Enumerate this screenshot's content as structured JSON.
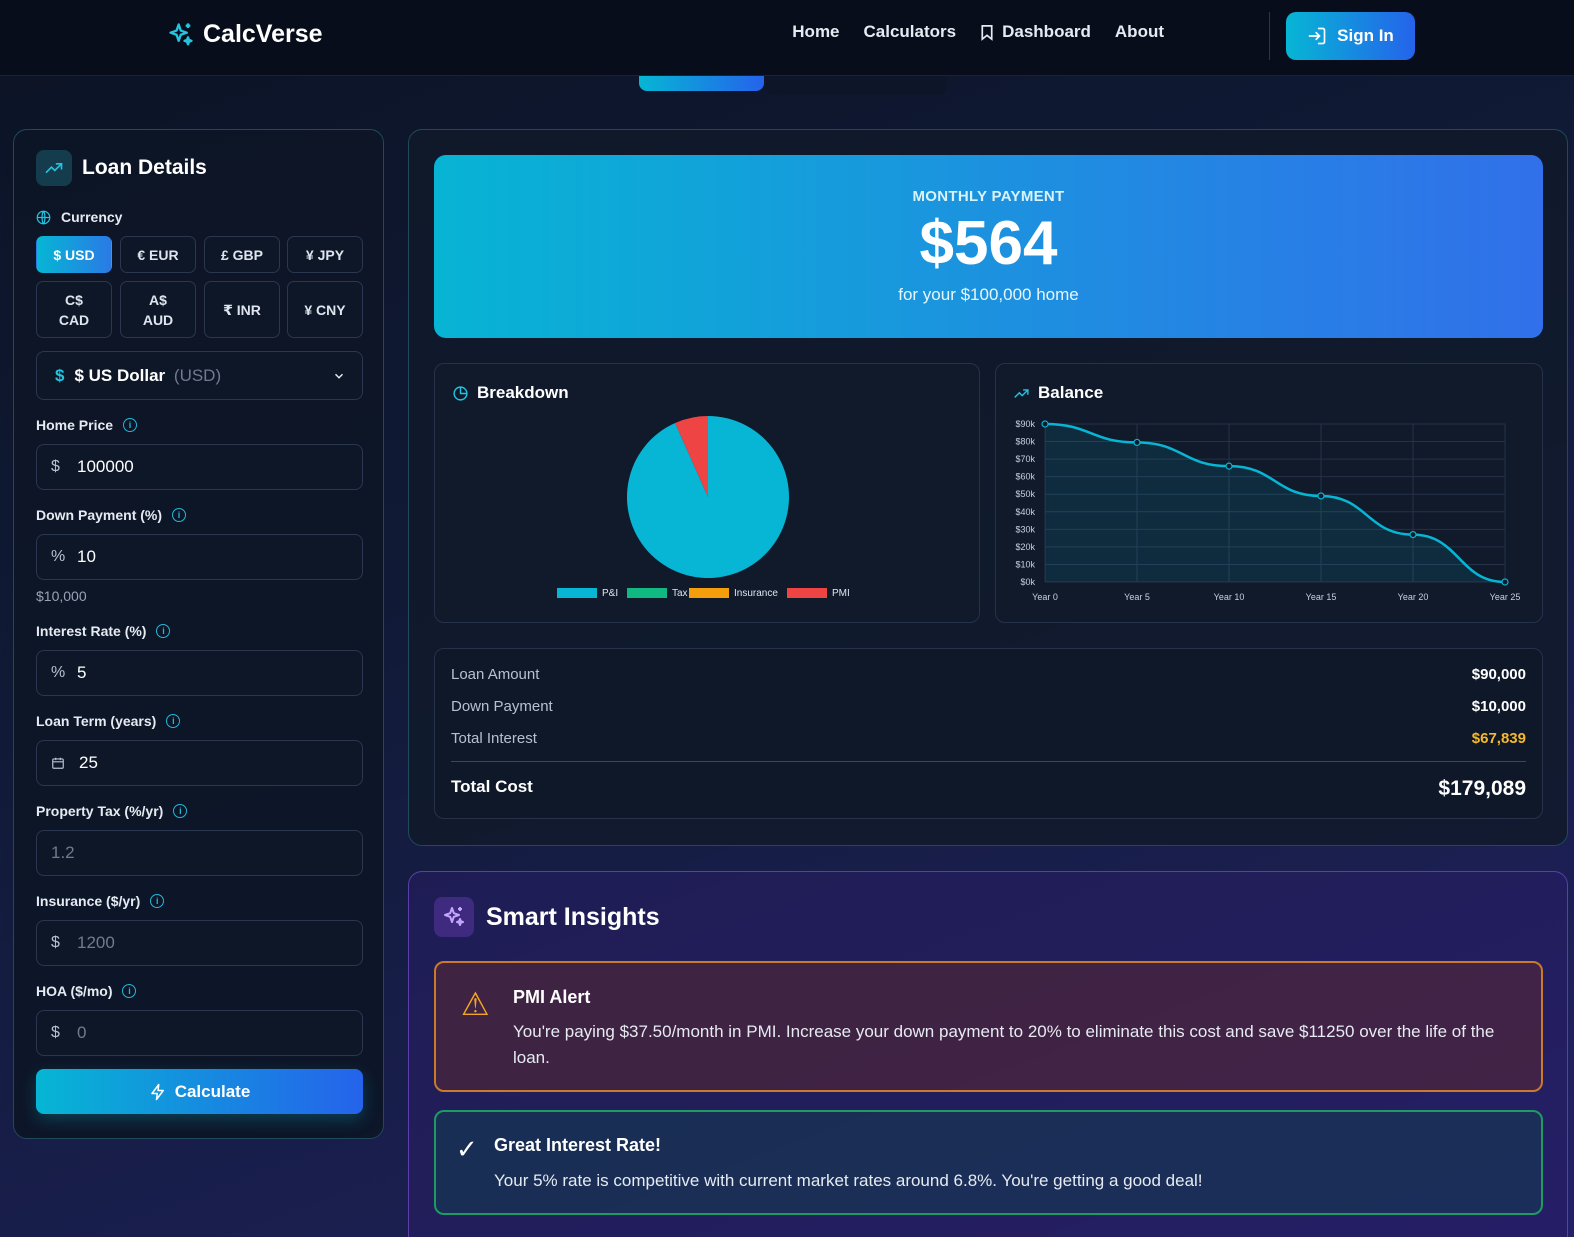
{
  "nav": {
    "brand": "CalcVerse",
    "links": [
      "Home",
      "Calculators",
      "Dashboard",
      "About"
    ],
    "signin": "Sign In"
  },
  "loan": {
    "title": "Loan Details",
    "currency_label": "Currency",
    "currencies": [
      {
        "line1": "$ USD",
        "line2": ""
      },
      {
        "line1": "€ EUR",
        "line2": ""
      },
      {
        "line1": "£ GBP",
        "line2": ""
      },
      {
        "line1": "¥ JPY",
        "line2": ""
      },
      {
        "line1": "C$",
        "line2": "CAD"
      },
      {
        "line1": "A$",
        "line2": "AUD"
      },
      {
        "line1": "₹ INR",
        "line2": ""
      },
      {
        "line1": "¥ CNY",
        "line2": ""
      }
    ],
    "select": {
      "symbol": "$",
      "name": "$ US Dollar",
      "code": "(USD)"
    },
    "fields": [
      {
        "label": "Home Price",
        "prefix": "$",
        "value": "100000",
        "placeholder": ""
      },
      {
        "label": "Down Payment (%)",
        "prefix": "%",
        "value": "10",
        "placeholder": ""
      },
      {
        "label": "Interest Rate (%)",
        "prefix": "%",
        "value": "5",
        "placeholder": ""
      },
      {
        "label": "Loan Term (years)",
        "prefix": "",
        "value": "25",
        "placeholder": ""
      },
      {
        "label": "Property Tax (%/yr)",
        "prefix": "",
        "value": "",
        "placeholder": "1.2"
      },
      {
        "label": "Insurance ($/yr)",
        "prefix": "$",
        "value": "",
        "placeholder": "1200"
      },
      {
        "label": "HOA ($/mo)",
        "prefix": "$",
        "value": "",
        "placeholder": "0"
      }
    ],
    "down_hint": "$10,000",
    "calculate": "Calculate"
  },
  "result": {
    "kicker": "MONTHLY PAYMENT",
    "amount": "$564",
    "sub": "for your $100,000 home",
    "breakdown_title": "Breakdown",
    "balance_title": "Balance",
    "summary": [
      {
        "k": "Loan Amount",
        "v": "$90,000"
      },
      {
        "k": "Down Payment",
        "v": "$10,000"
      },
      {
        "k": "Total Interest",
        "v": "$67,839"
      }
    ],
    "total_k": "Total Cost",
    "total_v": "$179,089"
  },
  "chart_data": [
    {
      "type": "pie",
      "labels": [
        "P&I",
        "Tax",
        "Insurance",
        "PMI"
      ],
      "values": [
        526,
        0,
        0,
        37.5
      ],
      "colors": [
        "#06b6d4",
        "#10b981",
        "#f59e0b",
        "#ef4444"
      ],
      "legend": "bottom"
    },
    {
      "type": "area",
      "x": [
        "Year 0",
        "Year 5",
        "Year 10",
        "Year 15",
        "Year 20",
        "Year 25"
      ],
      "values": [
        90,
        79.5,
        66,
        49,
        27,
        0
      ],
      "ylim": [
        0,
        90
      ],
      "yticks": [
        "$0k",
        "$10k",
        "$20k",
        "$30k",
        "$40k",
        "$50k",
        "$60k",
        "$70k",
        "$80k",
        "$90k"
      ],
      "grid": true,
      "color": "#06b6d4"
    }
  ],
  "insights": {
    "title": "Smart Insights",
    "warn_icon": "⚠",
    "warn_title": "PMI Alert",
    "warn_body": "You're paying $37.50/month in PMI. Increase your down payment to 20% to eliminate this cost and save $11250 over the life of the loan.",
    "ok_icon": "✓",
    "ok_title": "Great Interest Rate!",
    "ok_body": "Your 5% rate is competitive with current market rates around 6.8%. You're getting a good deal!"
  },
  "colors": {
    "accent": "#06b6d4",
    "accent2": "#2563eb",
    "interest": "#f5b82e"
  }
}
